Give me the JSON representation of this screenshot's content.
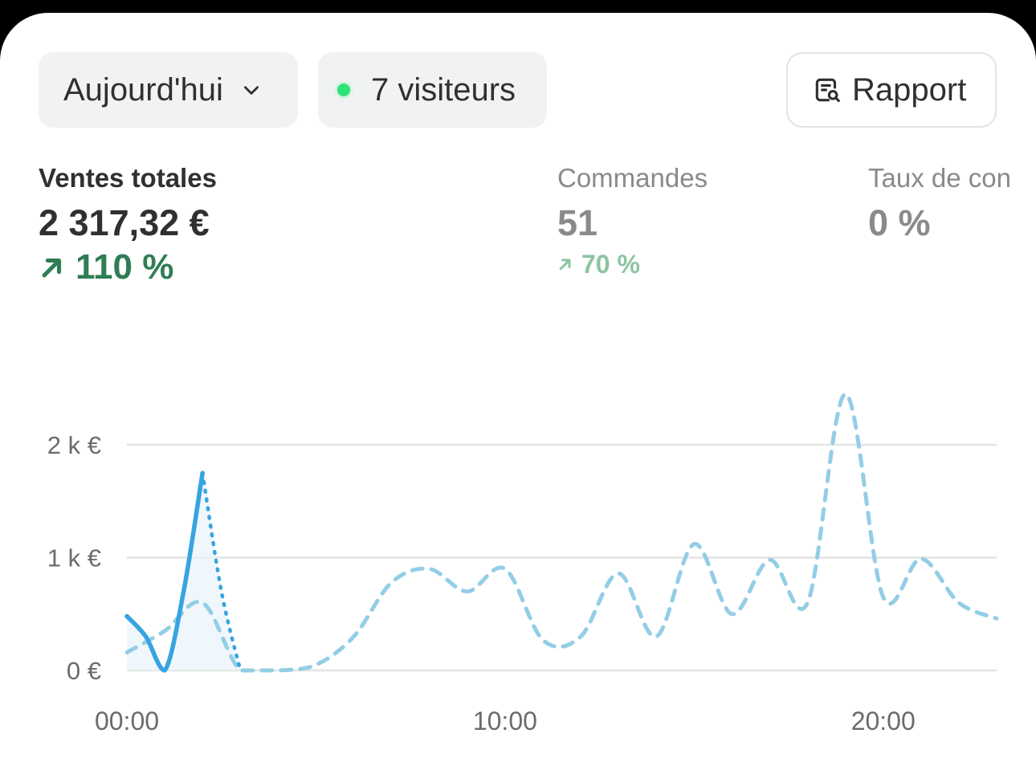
{
  "filters": {
    "date_label": "Aujourd'hui",
    "visitors_label": "7 visiteurs"
  },
  "report_label": "Rapport",
  "icons": {
    "date_chevron": "chevron-down-icon",
    "live_dot": "live-status-dot",
    "report": "report-search-icon",
    "trend_up": "arrow-up-right-icon"
  },
  "colors": {
    "trend_positive": "#2f7d55",
    "live_dot": "#2ee37a",
    "series_current": "#36a4e0",
    "series_previous": "#94cde6"
  },
  "metrics": [
    {
      "label": "Ventes totales",
      "value": "2 317,32 €",
      "change": "110 %"
    },
    {
      "label": "Commandes",
      "value": "51",
      "change": "70 %"
    },
    {
      "label": "Taux de con",
      "value": "0 %"
    }
  ],
  "chart_data": {
    "type": "line",
    "x_unit": "hours",
    "x_ticks": [
      0,
      10,
      20
    ],
    "x_tick_labels": [
      "00:00",
      "10:00",
      "20:00"
    ],
    "xlim": [
      0,
      23
    ],
    "y_ticks": [
      0,
      1000,
      2000
    ],
    "y_tick_labels": [
      "0 €",
      "1 k €",
      "2 k €"
    ],
    "ylim": [
      0,
      2000
    ],
    "grid": true,
    "series": [
      {
        "style": "solid",
        "x": [
          0,
          0.5,
          1,
          1.5,
          2
        ],
        "values": [
          480,
          300,
          0,
          700,
          1750
        ]
      },
      {
        "style": "dotted-projection",
        "x": [
          2,
          2.5,
          3
        ],
        "values": [
          1750,
          700,
          0
        ]
      },
      {
        "style": "dashed",
        "x": [
          0,
          1,
          2,
          3,
          4,
          5,
          6,
          7,
          8,
          9,
          10,
          11,
          12,
          13,
          14,
          15,
          16,
          17,
          18,
          19,
          20,
          21,
          22,
          23
        ],
        "values": [
          160,
          350,
          600,
          0,
          0,
          50,
          300,
          780,
          900,
          700,
          900,
          270,
          300,
          860,
          300,
          1120,
          500,
          980,
          600,
          2450,
          650,
          990,
          600,
          460
        ]
      }
    ]
  }
}
